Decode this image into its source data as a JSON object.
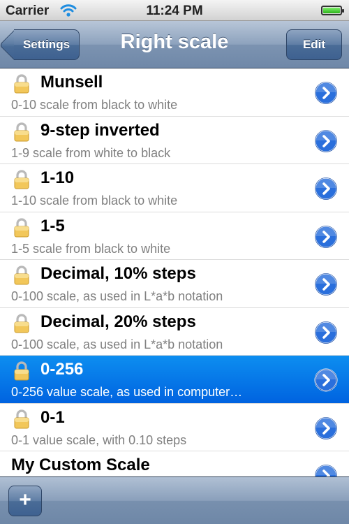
{
  "status_bar": {
    "carrier": "Carrier",
    "time": "11:24 PM",
    "wifi_icon": "wifi-icon",
    "battery_level": 1.0
  },
  "nav_bar": {
    "back_label": "Settings",
    "title": "Right scale",
    "edit_label": "Edit"
  },
  "list": {
    "items": [
      {
        "title": "Munsell",
        "subtitle": "0-10 scale from black to white",
        "locked": true,
        "selected": false
      },
      {
        "title": "9-step inverted",
        "subtitle": "1-9 scale from white to black",
        "locked": true,
        "selected": false
      },
      {
        "title": "1-10",
        "subtitle": "1-10 scale from black to white",
        "locked": true,
        "selected": false
      },
      {
        "title": "1-5",
        "subtitle": "1-5 scale from black to white",
        "locked": true,
        "selected": false
      },
      {
        "title": "Decimal, 10% steps",
        "subtitle": "0-100 scale, as used in L*a*b notation",
        "locked": true,
        "selected": false
      },
      {
        "title": "Decimal, 20% steps",
        "subtitle": "0-100 scale, as used in L*a*b notation",
        "locked": true,
        "selected": false
      },
      {
        "title": "0-256",
        "subtitle": "0-256 value scale, as used in computer…",
        "locked": true,
        "selected": true
      },
      {
        "title": "0-1",
        "subtitle": "0-1 value scale, with 0.10 steps",
        "locked": true,
        "selected": false
      },
      {
        "title": "My Custom Scale",
        "subtitle": "",
        "locked": false,
        "selected": false
      }
    ]
  },
  "toolbar": {
    "add_label": "+"
  },
  "colors": {
    "selection": "#0a74e8",
    "disclosure": "#2a6fdc"
  }
}
